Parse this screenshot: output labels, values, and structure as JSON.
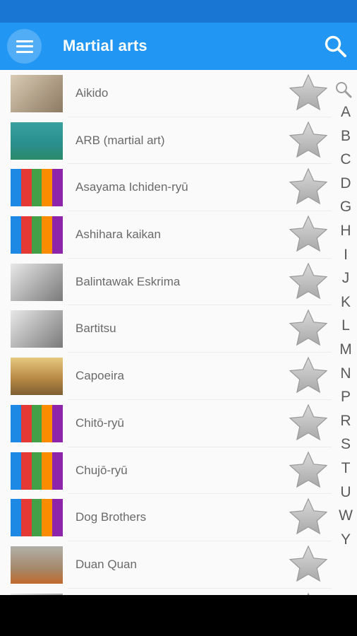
{
  "app": {
    "title": "Martial arts"
  },
  "colors": {
    "status_bar": "#1976d2",
    "app_bar": "#2196f3",
    "star": "#bdbdbd",
    "text": "#6a6a6a"
  },
  "icons": {
    "menu": "menu-icon",
    "search": "search-icon",
    "favorite": "star-icon",
    "index_search": "magnifier-icon"
  },
  "items": [
    {
      "label": "Aikido",
      "thumb": "photo-sepia"
    },
    {
      "label": "ARB (martial art)",
      "thumb": "photo-mat"
    },
    {
      "label": "Asayama Ichiden-ryū",
      "thumb": "rainbow"
    },
    {
      "label": "Ashihara kaikan",
      "thumb": "rainbow"
    },
    {
      "label": "Balintawak Eskrima",
      "thumb": "photo-bw"
    },
    {
      "label": "Bartitsu",
      "thumb": "photo-bw"
    },
    {
      "label": "Capoeira",
      "thumb": "photo-paint"
    },
    {
      "label": "Chitō-ryū",
      "thumb": "rainbow"
    },
    {
      "label": "Chujō-ryū",
      "thumb": "rainbow"
    },
    {
      "label": "Dog Brothers",
      "thumb": "rainbow"
    },
    {
      "label": "Duan Quan",
      "thumb": "photo-duan"
    },
    {
      "label": "",
      "thumb": "photo-bw"
    }
  ],
  "alphabet": [
    "A",
    "B",
    "C",
    "D",
    "G",
    "H",
    "I",
    "J",
    "K",
    "L",
    "M",
    "N",
    "P",
    "R",
    "S",
    "T",
    "U",
    "W",
    "Y"
  ]
}
